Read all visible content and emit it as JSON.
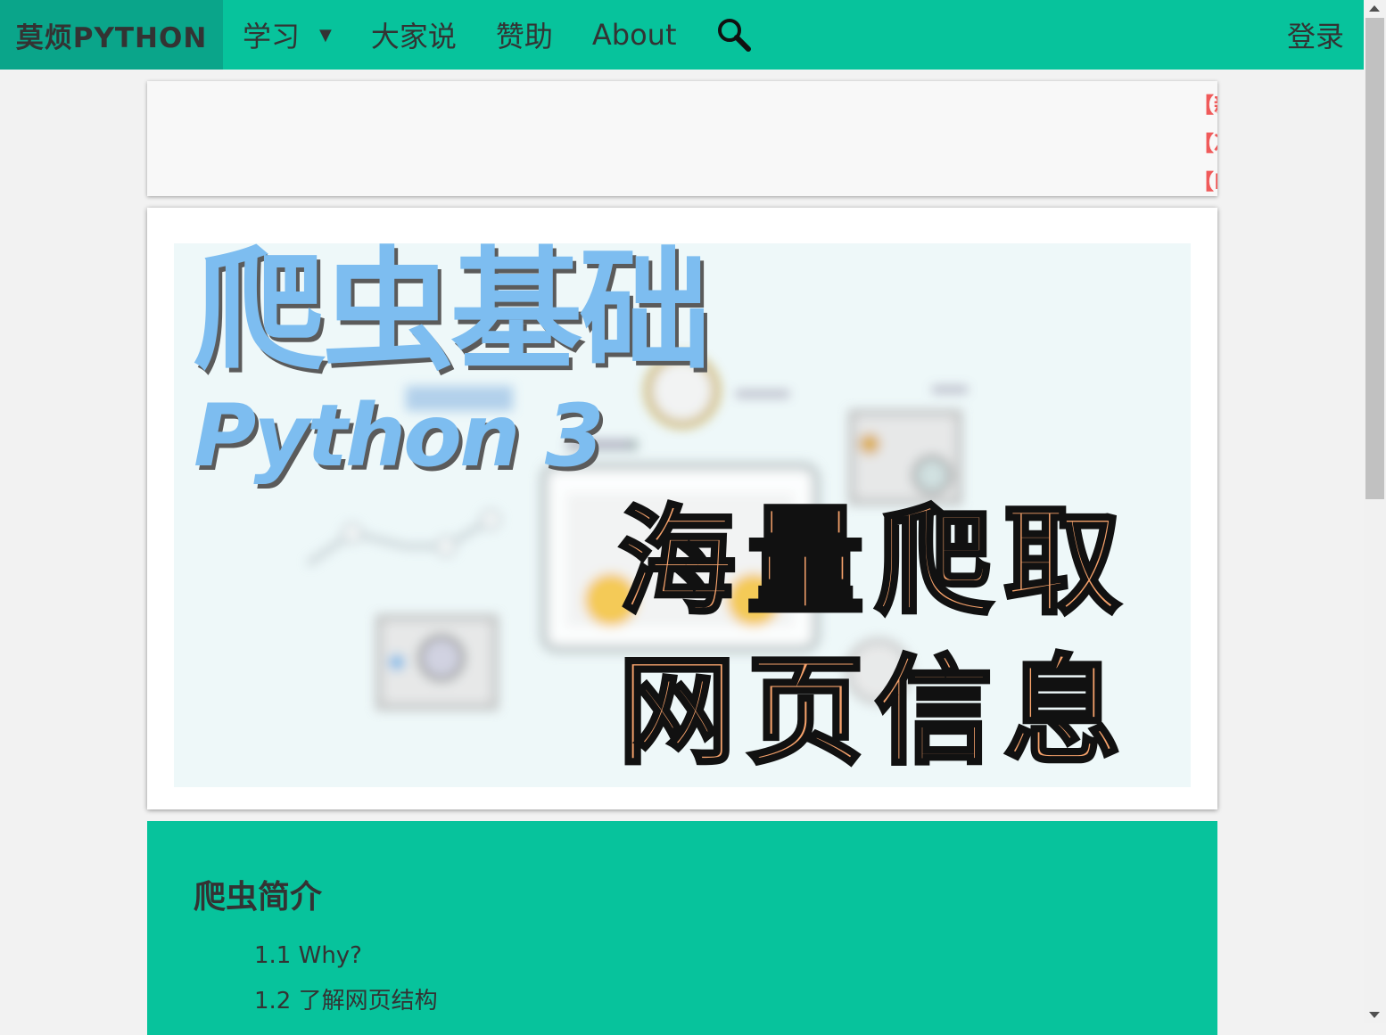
{
  "navbar": {
    "brand": "莫烦PYTHON",
    "learn_label": "学习",
    "learn_caret": "▼",
    "forum_label": "大家说",
    "sponsor_label": "赞助",
    "about_label": "About",
    "search_icon": "search-icon",
    "login_label": "登录"
  },
  "notices": [
    {
      "label": "【新"
    },
    {
      "label": "【次"
    },
    {
      "label": "【M"
    }
  ],
  "banner": {
    "title": "爬虫基础",
    "subtitle": "Python 3",
    "line1": "海量爬取",
    "line2": "网页信息"
  },
  "toc": {
    "title": "爬虫简介",
    "items": [
      {
        "label": "1.1 Why?"
      },
      {
        "label": "1.2 了解网页结构"
      }
    ]
  },
  "colors": {
    "brand_green": "#07c39c",
    "brand_dark": "#0aa58a",
    "notice_red": "#f05a5a",
    "title_blue": "#7dbdf0",
    "title_orange": "#f6a26b"
  }
}
